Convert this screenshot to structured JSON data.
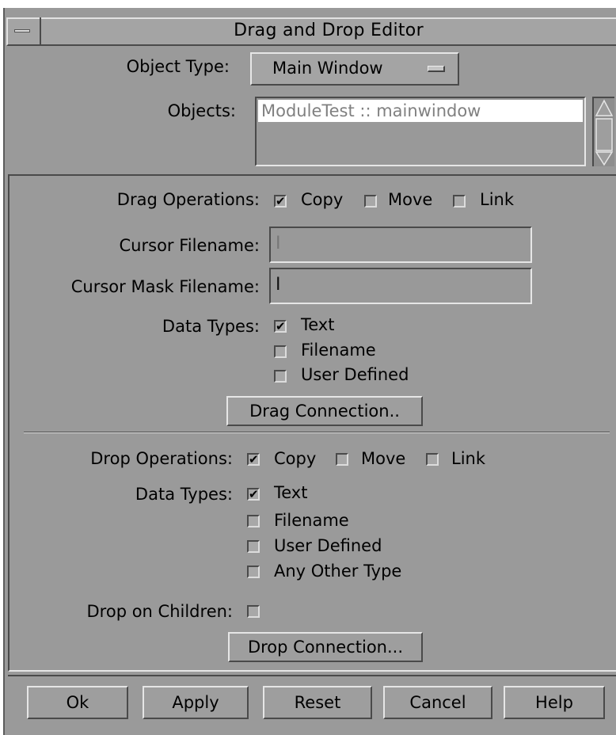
{
  "window": {
    "title": "Drag and Drop Editor"
  },
  "object_type": {
    "label": "Object Type:",
    "value": "Main Window"
  },
  "objects": {
    "label": "Objects:",
    "items": [
      "ModuleTest :: mainwindow"
    ]
  },
  "drag": {
    "operations_label": "Drag Operations:",
    "copy": "Copy",
    "move": "Move",
    "link": "Link",
    "cursor_filename_label": "Cursor Filename:",
    "cursor_filename_value": "",
    "cursor_mask_label": "Cursor Mask Filename:",
    "cursor_mask_value": "",
    "data_types_label": "Data Types:",
    "text": "Text",
    "filename": "Filename",
    "user_defined": "User Defined",
    "connection_button": "Drag Connection.."
  },
  "drop": {
    "operations_label": "Drop Operations:",
    "copy": "Copy",
    "move": "Move",
    "link": "Link",
    "data_types_label": "Data Types:",
    "text": "Text",
    "filename": "Filename",
    "user_defined": "User Defined",
    "any_other": "Any Other Type",
    "on_children_label": "Drop on Children:",
    "connection_button": "Drop Connection..."
  },
  "checks": {
    "drag_copy": true,
    "drag_move": false,
    "drag_link": false,
    "drag_text": true,
    "drag_filename": false,
    "drag_user": false,
    "drop_copy": true,
    "drop_move": false,
    "drop_link": false,
    "drop_text": true,
    "drop_filename": false,
    "drop_user": false,
    "drop_any": false,
    "drop_children": false
  },
  "buttons": {
    "ok": "Ok",
    "apply": "Apply",
    "reset": "Reset",
    "cancel": "Cancel",
    "help": "Help"
  },
  "colors": {
    "background": "#9a9a9a",
    "highlight": "#e6e6e6",
    "shadow": "#4a4a4a",
    "list_text": "#808080"
  }
}
